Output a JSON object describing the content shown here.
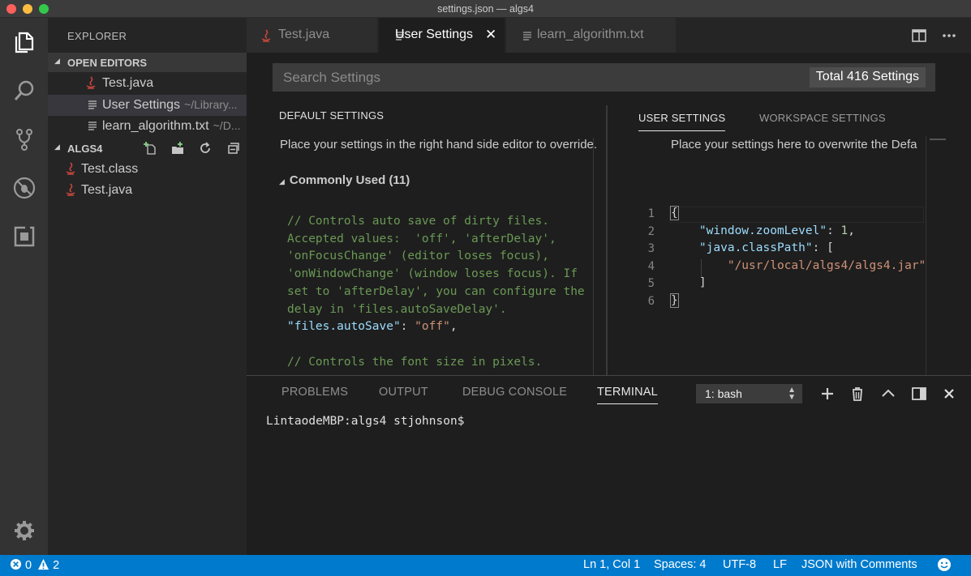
{
  "window": {
    "title": "settings.json — algs4"
  },
  "colors": {
    "accent": "#007acc",
    "java_icon": "#c5463c",
    "comment": "#6a9955",
    "key": "#9cdcfe",
    "string": "#ce9178"
  },
  "activity_bar": {
    "items": [
      {
        "icon": "files-icon"
      },
      {
        "icon": "search-icon"
      },
      {
        "icon": "source-control-icon"
      },
      {
        "icon": "debug-icon"
      },
      {
        "icon": "extensions-icon"
      }
    ],
    "bottom_icon": "gear-icon"
  },
  "sidebar": {
    "header": "EXPLORER",
    "open_editors": {
      "label": "OPEN EDITORS",
      "items": [
        {
          "name": "Test.java",
          "path": ""
        },
        {
          "name": "User Settings",
          "path": "~/Library..."
        },
        {
          "name": "learn_algorithm.txt",
          "path": "~/D..."
        }
      ]
    },
    "folder": {
      "label": "ALGS4",
      "items": [
        {
          "name": "Test.class"
        },
        {
          "name": "Test.java"
        }
      ]
    }
  },
  "tabs": [
    {
      "label": "Test.java",
      "active": false
    },
    {
      "label": "User Settings",
      "active": true,
      "close": "✕"
    },
    {
      "label": "learn_algorithm.txt",
      "active": false
    }
  ],
  "settings": {
    "search_placeholder": "Search Settings",
    "total": "Total 416 Settings",
    "default_title": "DEFAULT SETTINGS",
    "default_desc": "Place your settings in the right hand side editor to override.",
    "group": "Commonly Used (11)",
    "user_tab": "USER SETTINGS",
    "workspace_tab": "WORKSPACE SETTINGS",
    "user_desc": "Place your settings here to overwrite the Defa",
    "default_code": {
      "comment_lines": [
        "// Controls auto save of dirty files.",
        "Accepted values:  'off', 'afterDelay',",
        "'onFocusChange' (editor loses focus),",
        "'onWindowChange' (window loses focus). If",
        "set to 'afterDelay', you can configure the",
        "delay in 'files.autoSaveDelay'."
      ],
      "setting_key": "\"files.autoSave\"",
      "setting_value": "\"off\"",
      "comment2": "// Controls the font size in pixels."
    },
    "user_code": {
      "line_numbers": [
        "1",
        "2",
        "3",
        "4",
        "5",
        "6"
      ],
      "open_brace": "{",
      "zoom_key": "\"window.zoomLevel\"",
      "zoom_value": "1",
      "classpath_key": "\"java.classPath\"",
      "classpath_value": "\"/usr/local/algs4/algs4.jar\"",
      "close_bracket": "]",
      "close_brace": "}"
    }
  },
  "panel": {
    "tabs": [
      "PROBLEMS",
      "OUTPUT",
      "DEBUG CONSOLE",
      "TERMINAL"
    ],
    "active_tab": "TERMINAL",
    "terminal_select": "1: bash",
    "prompt": "LintaodeMBP:algs4 stjohnson$"
  },
  "status_bar": {
    "errors": "0",
    "warnings": "2",
    "position": "Ln 1, Col 1",
    "spaces": "Spaces: 4",
    "encoding": "UTF-8",
    "eol": "LF",
    "language": "JSON with Comments"
  }
}
